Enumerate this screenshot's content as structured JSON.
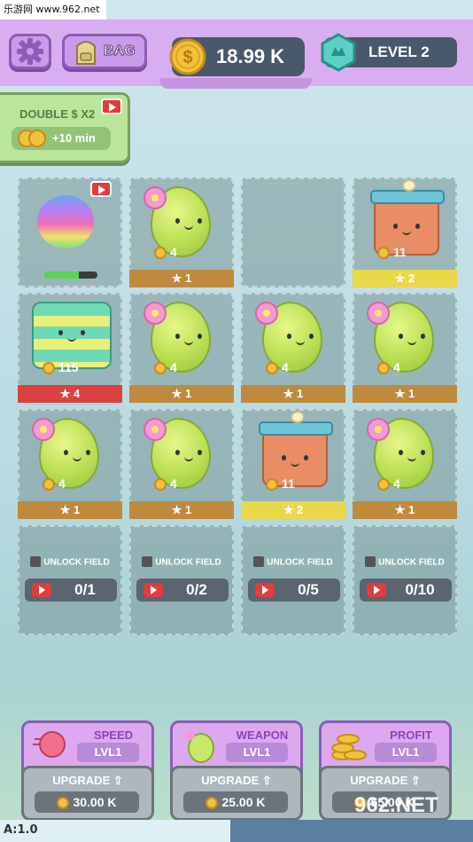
{
  "watermark_top": "乐游网 www.962.net",
  "topbar": {
    "bag_label": "BAG",
    "coins": "18.99 K",
    "level": "LEVEL 2"
  },
  "double_panel": {
    "title": "DOUBLE $ X2",
    "bonus": "+10 min"
  },
  "grid": {
    "rows": [
      [
        {
          "kind": "pinata",
          "stars": "",
          "income": "",
          "hp_fraction": 0.65
        },
        {
          "kind": "blob",
          "stars": "1",
          "income": "4",
          "star_color": "brown"
        },
        {
          "kind": "empty"
        },
        {
          "kind": "box",
          "stars": "2",
          "income": "11",
          "star_color": "yellow"
        }
      ],
      [
        {
          "kind": "stripe",
          "stars": "4",
          "income": "115",
          "star_color": "red"
        },
        {
          "kind": "blob",
          "stars": "1",
          "income": "4",
          "star_color": "brown"
        },
        {
          "kind": "blob",
          "stars": "1",
          "income": "4",
          "star_color": "brown"
        },
        {
          "kind": "blob",
          "stars": "1",
          "income": "4",
          "star_color": "brown"
        }
      ],
      [
        {
          "kind": "blob",
          "stars": "1",
          "income": "4",
          "star_color": "brown"
        },
        {
          "kind": "blob",
          "stars": "1",
          "income": "4",
          "star_color": "brown"
        },
        {
          "kind": "box",
          "stars": "2",
          "income": "11",
          "star_color": "yellow"
        },
        {
          "kind": "blob",
          "stars": "1",
          "income": "4",
          "star_color": "brown"
        }
      ]
    ],
    "locked": [
      {
        "title": "UNLOCK FIELD",
        "count": "0/1"
      },
      {
        "title": "UNLOCK FIELD",
        "count": "0/2"
      },
      {
        "title": "UNLOCK FIELD",
        "count": "0/5"
      },
      {
        "title": "UNLOCK FIELD",
        "count": "0/10"
      }
    ]
  },
  "upgrades": [
    {
      "title": "SPEED",
      "level": "LVL1",
      "button": "UPGRADE",
      "price": "30.00 K",
      "icon": "pinata-icon"
    },
    {
      "title": "WEAPON",
      "level": "LVL1",
      "button": "UPGRADE",
      "price": "25.00 K",
      "icon": "blob-icon"
    },
    {
      "title": "PROFIT",
      "level": "LVL1",
      "button": "UPGRADE",
      "price": "55.00 K",
      "icon": "coin-stack-icon"
    }
  ],
  "version": "A:1.0",
  "watermark_bottom": "962.NET",
  "colors": {
    "topbar": "#d9aef0",
    "coin_pill": "#4a586b",
    "star_brown": "#c08a3e",
    "star_yellow": "#e8d84a",
    "star_red": "#d9423e"
  }
}
